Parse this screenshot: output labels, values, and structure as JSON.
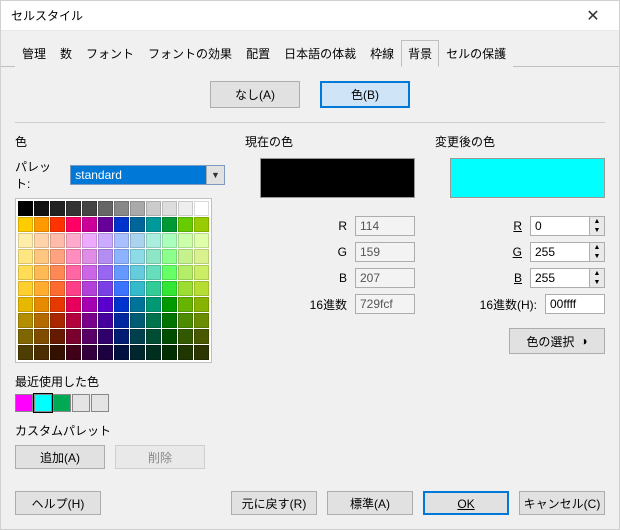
{
  "window": {
    "title": "セルスタイル"
  },
  "tabs": {
    "items": [
      {
        "label": "管理"
      },
      {
        "label": "数"
      },
      {
        "label": "フォント"
      },
      {
        "label": "フォントの効果"
      },
      {
        "label": "配置"
      },
      {
        "label": "日本語の体裁"
      },
      {
        "label": "枠線"
      },
      {
        "label": "背景"
      },
      {
        "label": "セルの保護"
      }
    ],
    "active_index": 7
  },
  "mode": {
    "none_label": "なし(A)",
    "color_label": "色(B)"
  },
  "left": {
    "title": "色",
    "palette_label": "パレット:",
    "palette_value": "standard",
    "recent_label": "最近使用した色",
    "custom_label": "カスタムパレット",
    "add_label": "追加(A)",
    "delete_label": "削除"
  },
  "palette_rows": [
    [
      "#000000",
      "#111111",
      "#222222",
      "#333333",
      "#444444",
      "#666666",
      "#888888",
      "#aaaaaa",
      "#cccccc",
      "#dddddd",
      "#eeeeee",
      "#ffffff"
    ],
    [
      "#ffcc00",
      "#ff9900",
      "#ff3300",
      "#ff0066",
      "#cc0099",
      "#660099",
      "#0033cc",
      "#006699",
      "#009999",
      "#009933",
      "#66cc00",
      "#99cc00"
    ],
    [
      "#ffeeaa",
      "#ffd4aa",
      "#ffbbaa",
      "#ffaacc",
      "#eeaaff",
      "#ccaaff",
      "#aabfff",
      "#aad4ee",
      "#aaeedd",
      "#aaffbb",
      "#ccffaa",
      "#e0ffaa"
    ],
    [
      "#ffe680",
      "#ffc680",
      "#ffa280",
      "#ff8dbf",
      "#e08de6",
      "#b38df2",
      "#8db3ff",
      "#8ddbe6",
      "#8de6c6",
      "#8dff8d",
      "#c6f28d",
      "#d9f28d"
    ],
    [
      "#ffdd55",
      "#ffb955",
      "#ff8855",
      "#ff66a3",
      "#cc66e6",
      "#9966f2",
      "#6699ff",
      "#66ccdd",
      "#66ddbb",
      "#66ff66",
      "#b3ee66",
      "#ccee66"
    ],
    [
      "#ffcf2f",
      "#ffac2f",
      "#ff6a2f",
      "#ff4088",
      "#b340d9",
      "#7a40e6",
      "#3b73ff",
      "#33bbcc",
      "#33cc99",
      "#33e633",
      "#9bdd33",
      "#b7dd33"
    ],
    [
      "#e6b800",
      "#e68a00",
      "#e63900",
      "#e6005c",
      "#a600b3",
      "#5a00cc",
      "#0033cc",
      "#007399",
      "#009973",
      "#009900",
      "#66b300",
      "#88b300"
    ],
    [
      "#b38f00",
      "#b36b00",
      "#aa2600",
      "#b3003f",
      "#7a008c",
      "#46009e",
      "#00279e",
      "#005c73",
      "#00734d",
      "#007300",
      "#4d8c00",
      "#6a8c00"
    ],
    [
      "#806600",
      "#804d00",
      "#661a00",
      "#7a002d",
      "#590066",
      "#30006b",
      "#001c73",
      "#00404d",
      "#004d33",
      "#004d00",
      "#335900",
      "#485900"
    ],
    [
      "#4d3d00",
      "#4d2e00",
      "#331000",
      "#40001a",
      "#33003d",
      "#1c0040",
      "#001140",
      "#00262e",
      "#002e1f",
      "#002e00",
      "#1f3600",
      "#2b3600"
    ]
  ],
  "recent_colors": [
    "#ff00ff",
    "#00ffff",
    "#00aa55",
    "#e4e4e4",
    "#e4e4e4"
  ],
  "recent_selected_index": 1,
  "current": {
    "title": "現在の色",
    "color": "#000000",
    "r_label": "R",
    "r_value": "114",
    "g_label": "G",
    "g_value": "159",
    "b_label": "B",
    "b_value": "207",
    "hex_label": "16進数",
    "hex_value": "729fcf"
  },
  "newc": {
    "title": "変更後の色",
    "color": "#00ffff",
    "r_label": "R",
    "r_value": "0",
    "g_label": "G",
    "g_value": "255",
    "b_label": "B",
    "b_value": "255",
    "hex_label": "16進数(H):",
    "hex_value": "00ffff",
    "pick_label": "色の選択"
  },
  "footer": {
    "help": "ヘルプ(H)",
    "reset": "元に戻す(R)",
    "standard": "標準(A)",
    "ok": "OK",
    "cancel": "キャンセル(C)"
  }
}
